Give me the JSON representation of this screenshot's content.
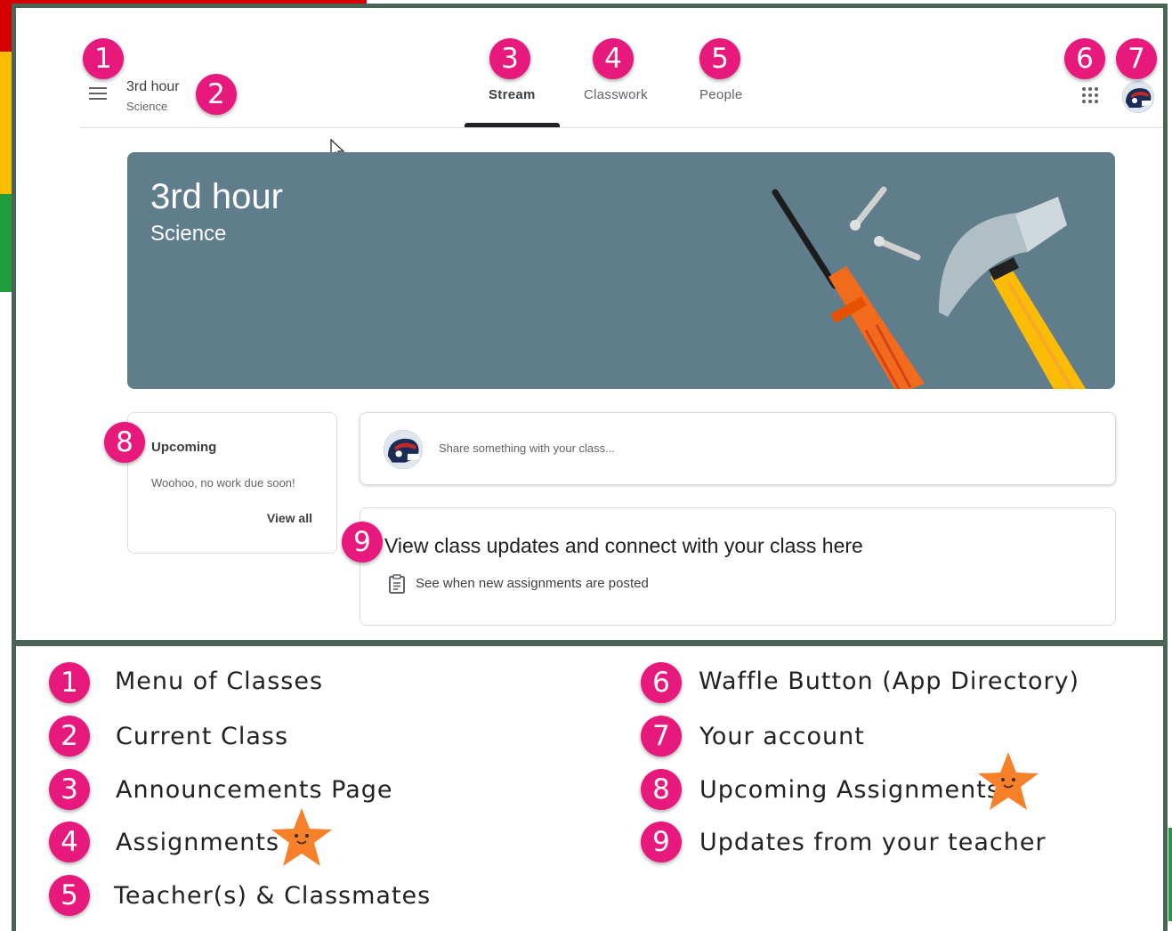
{
  "header": {
    "class_title": "3rd hour",
    "class_subtitle": "Science",
    "tabs": [
      {
        "label": "Stream",
        "active": true
      },
      {
        "label": "Classwork",
        "active": false
      },
      {
        "label": "People",
        "active": false
      }
    ]
  },
  "banner": {
    "title": "3rd hour",
    "subtitle": "Science",
    "color": "#607d8b"
  },
  "upcoming": {
    "title": "Upcoming",
    "message": "Woohoo, no work due soon!",
    "view_all": "View all"
  },
  "share": {
    "placeholder": "Share something with your class..."
  },
  "updates": {
    "title": "View class updates and connect with your class here",
    "subtitle": "See when new assignments are posted"
  },
  "callouts": [
    "1",
    "2",
    "3",
    "4",
    "5",
    "6",
    "7",
    "8",
    "9"
  ],
  "legend": [
    {
      "num": "1",
      "text": "Menu of Classes"
    },
    {
      "num": "2",
      "text": "Current Class"
    },
    {
      "num": "3",
      "text": "Announcements Page"
    },
    {
      "num": "4",
      "text": "Assignments"
    },
    {
      "num": "5",
      "text": "Teacher(s) & Classmates"
    },
    {
      "num": "6",
      "text": "Waffle Button (App Directory)"
    },
    {
      "num": "7",
      "text": "Your account"
    },
    {
      "num": "8",
      "text": "Upcoming Assignments"
    },
    {
      "num": "9",
      "text": "Updates from your teacher"
    }
  ],
  "colors": {
    "callout": "#e8197d",
    "frame": "#4a6556",
    "star": "#f7812b"
  }
}
